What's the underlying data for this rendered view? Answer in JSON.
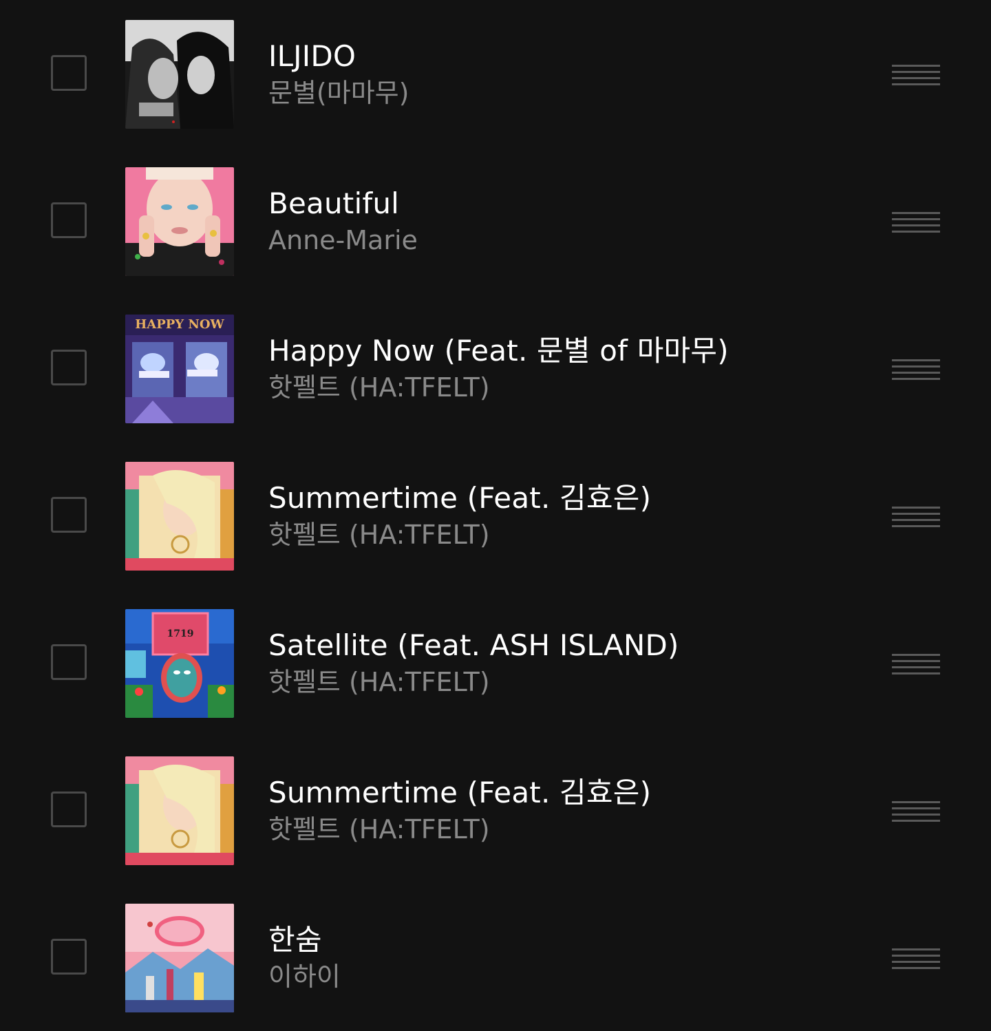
{
  "playlist": {
    "tracks": [
      {
        "title": "ILJIDO",
        "artist": "문별(마마무)",
        "cover_icon": "album-cover-iljido",
        "cover_colors": [
          "#1a1a1a",
          "#e8e8e8"
        ]
      },
      {
        "title": "Beautiful",
        "artist": "Anne-Marie",
        "cover_icon": "album-cover-beautiful",
        "cover_colors": [
          "#f07aa0",
          "#f4d3c4"
        ]
      },
      {
        "title": "Happy Now (Feat. 문별 of 마마무)",
        "artist": "핫펠트 (HA:TFELT)",
        "cover_icon": "album-cover-happy-now",
        "cover_text": "HAPPY NOW",
        "cover_colors": [
          "#3a2a70",
          "#8fb6ff"
        ]
      },
      {
        "title": "Summertime (Feat. 김효은)",
        "artist": "핫펠트 (HA:TFELT)",
        "cover_icon": "album-cover-summertime",
        "cover_colors": [
          "#f06a6a",
          "#f4e0b0"
        ]
      },
      {
        "title": "Satellite (Feat. ASH ISLAND)",
        "artist": "핫펠트 (HA:TFELT)",
        "cover_icon": "album-cover-satellite",
        "cover_text": "1719",
        "cover_colors": [
          "#1e4fb0",
          "#e04a6a"
        ]
      },
      {
        "title": "Summertime (Feat. 김효은)",
        "artist": "핫펠트 (HA:TFELT)",
        "cover_icon": "album-cover-summertime",
        "cover_colors": [
          "#f06a6a",
          "#f4e0b0"
        ]
      },
      {
        "title": "한숨",
        "artist": "이하이",
        "cover_icon": "album-cover-hansum",
        "cover_colors": [
          "#f4a0b0",
          "#6aa0d0"
        ]
      }
    ]
  }
}
